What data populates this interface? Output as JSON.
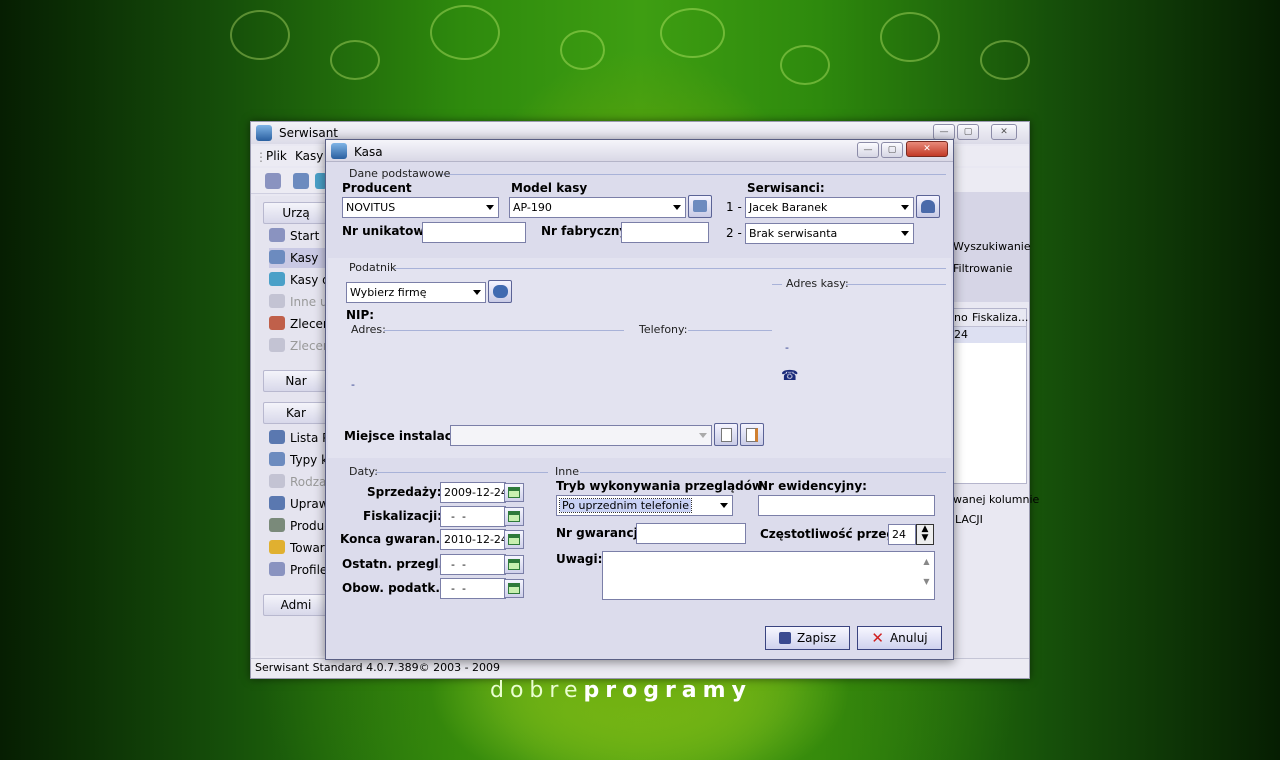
{
  "back_window": {
    "title": "Serwisant",
    "menu": [
      "Plik",
      "Kasy"
    ],
    "nav_header": "Urzą",
    "nav_items": [
      "Start",
      "Kasy",
      "Kasy do",
      "Inne urz",
      "Zleceni",
      "Zleceni"
    ],
    "nav_header2": "Nar",
    "nav_header3": "Kar",
    "nav_items2": [
      "Lista Po",
      "Typy ka",
      "Rodzaje",
      "Uprawn",
      "Produce",
      "Towary",
      "Profile p"
    ],
    "nav_header4": "Admi",
    "right_links": [
      "Wyszukiwanie",
      "Filtrowanie"
    ],
    "grid_headers": [
      "no",
      "Fiskaliza..."
    ],
    "grid_cell": "24",
    "right_text1": "wanej kolumnie",
    "right_text2": "LACJI",
    "status": "Serwisant Standard 4.0.7.389© 2003 - 2009"
  },
  "dialog": {
    "title": "Kasa",
    "sections": {
      "basic": "Dane podstawowe",
      "taxpayer": "Podatnik",
      "dates": "Daty:",
      "other": "Inne"
    },
    "labels": {
      "producer": "Producent",
      "model": "Model kasy",
      "servicers": "Serwisanci:",
      "unique_no": "Nr unikatowy",
      "factory_no": "Nr fabryczny:",
      "nip": "NIP:",
      "address": "Adres:",
      "phones": "Telefony:",
      "register_address": "Adres kasy:",
      "install_place": "Miejsce instalacji:",
      "sale": "Sprzedaży:",
      "fiscal": "Fiskalizacji:",
      "warranty_end": "Konca gwaran.:",
      "last_review": "Ostatn. przegl.:",
      "tax_duty": "Obow. podatk.:",
      "review_mode": "Tryb wykonywania przeglądów:",
      "evidence_no": "Nr ewidencyjny:",
      "warranty_no": "Nr gwarancji:",
      "review_freq": "Częstotliwość przegl.:",
      "notes": "Uwagi:",
      "serv1": "1 -",
      "serv2": "2 -"
    },
    "values": {
      "producer": "NOVITUS",
      "model": "AP-190",
      "servicer1": "Jacek Baranek",
      "servicer2": "Brak serwisanta",
      "unique_no": "",
      "factory_no": "",
      "company": "Wybierz firmę",
      "addr_dash": "-",
      "right_dash": "-",
      "install_place": "",
      "sale": "2009-12-24",
      "fiscal": "  -  -",
      "warranty_end": "2010-12-24",
      "last_review": "  -  -",
      "tax_duty": "  -  -",
      "review_mode": "Po uprzednim telefonie",
      "evidence_no": "",
      "warranty_no": "",
      "review_freq": "24",
      "notes": ""
    },
    "buttons": {
      "save": "Zapisz",
      "cancel": "Anuluj"
    }
  },
  "watermark": {
    "light": "dobre",
    "bold": "programy"
  }
}
